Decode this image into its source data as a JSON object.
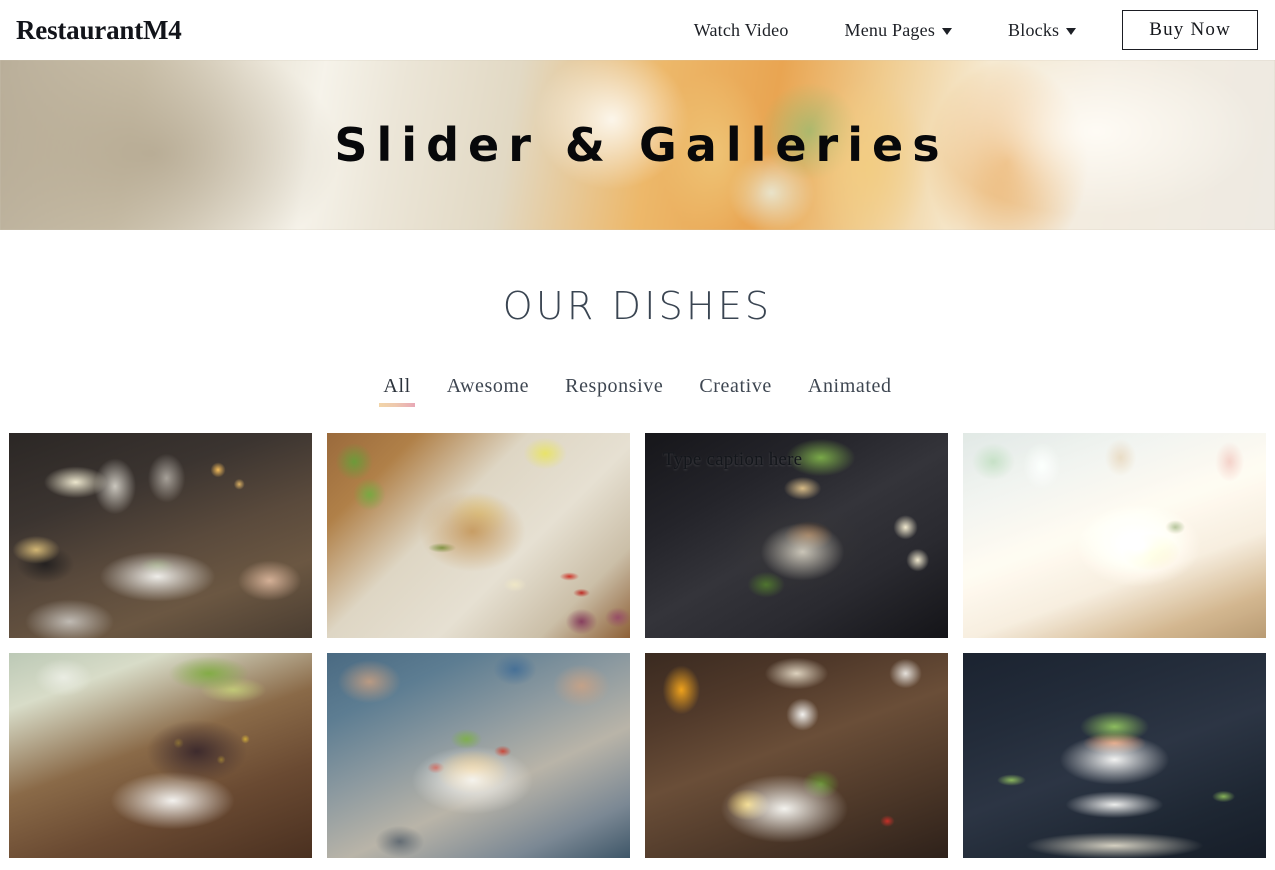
{
  "header": {
    "brand": "RestaurantM4",
    "nav": [
      {
        "label": "Watch Video",
        "has_caret": false
      },
      {
        "label": "Menu Pages",
        "has_caret": true
      },
      {
        "label": "Blocks",
        "has_caret": true
      }
    ],
    "buy_button": "Buy Now"
  },
  "hero": {
    "title": "Slider & Galleries"
  },
  "section": {
    "title": "OUR DISHES",
    "filters": [
      {
        "label": "All",
        "active": true
      },
      {
        "label": "Awesome",
        "active": false
      },
      {
        "label": "Responsive",
        "active": false
      },
      {
        "label": "Creative",
        "active": false
      },
      {
        "label": "Animated",
        "active": false
      }
    ],
    "gallery": [
      {
        "alt": "restaurant-dinner-table-with-wine-glasses",
        "caption": ""
      },
      {
        "alt": "noodle-salad-on-wooden-board-with-lime-and-chili",
        "caption": ""
      },
      {
        "alt": "pork-noodle-soup-with-egg-in-dark-bowl",
        "caption": "Type caption here"
      },
      {
        "alt": "pasta-in-white-bowl-on-wooden-table",
        "caption": ""
      },
      {
        "alt": "black-rice-and-mango-salad-in-white-bowl",
        "caption": ""
      },
      {
        "alt": "loaded-nachos-plate-shared-by-hands",
        "caption": ""
      },
      {
        "alt": "eggs-benedict-brunch-with-orange-juice",
        "caption": ""
      },
      {
        "alt": "sushi-rice-block-with-avocado-and-spicy-mayo",
        "caption": ""
      }
    ]
  },
  "colors": {
    "text_dark": "#1d2026",
    "heading": "#3a4552",
    "underline_start": "#f2d5a8",
    "underline_end": "#e8a8b6",
    "page_background": "#ffffff"
  }
}
